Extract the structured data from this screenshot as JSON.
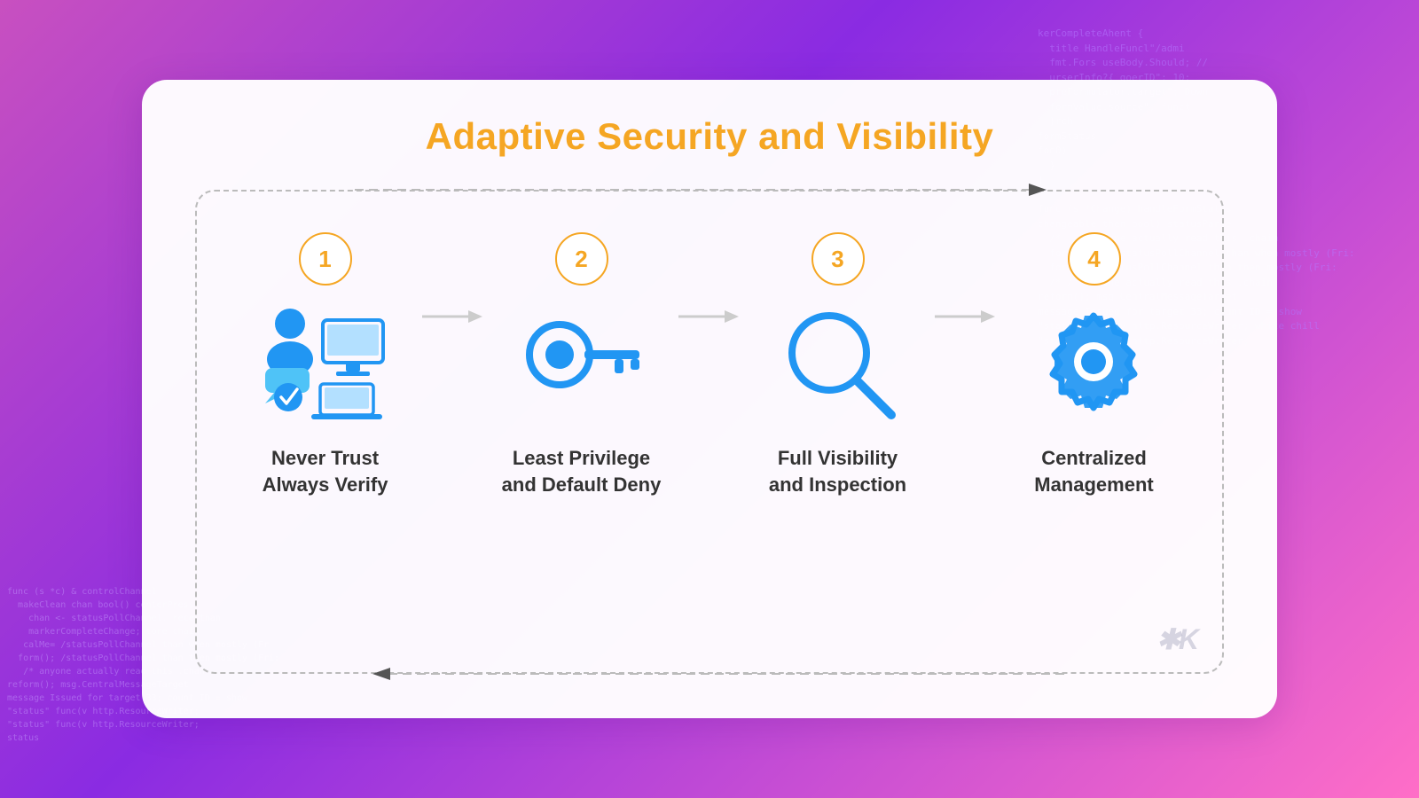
{
  "page": {
    "title": "Adaptive Security and Visibility",
    "background_gradient": "linear-gradient(135deg, #c850c0 0%, #8a2be2 40%, #ff6ec7 100%)"
  },
  "steps": [
    {
      "number": "1",
      "label": "Never Trust\nAlways Verify",
      "icon": "user-device-icon"
    },
    {
      "number": "2",
      "label": "Least Privilege\nand Default Deny",
      "icon": "key-icon"
    },
    {
      "number": "3",
      "label": "Full Visibility\nand Inspection",
      "icon": "magnify-icon"
    },
    {
      "number": "4",
      "label": "Centralized\nManagement",
      "icon": "gear-icon"
    }
  ],
  "top_arrow_label": "→",
  "bottom_arrow_label": "←",
  "watermark": "✱K",
  "code_text_right": "kerCompleteAhent {\n  title HandleFuncl\"/admi\n  fmt.Fors useBody.Should; //\n  urserInfo?{ goerID\"; 10;\n  preFormulator.target\"; Down\n  formValue.source\"; funct\n  }rch\nformStatus\nfoo0);\n  }\n}\n\nfunc (s *Change) handleFormStatus\nchangeable then bool) statusParse\n  /* --> anyone actually read this .chain\n  formGetML; /statusPollChannel than when mostly (Fri:\n  form(); /statusPollChannel than then mostly (Fri:\n  /* /* anyone actually read this .chain\nreform(); msg.CentralMessageTarget\nmessage Issued for target 33; count ID = show\n\"status\" func(v http.ResourceWriter; white chill\n\"status\" func(v http.ResourceWriter;",
  "code_text_left": "func (s *c) & controlChannel\n  makeClean chan bool() centerPress\n    chan <- statusPollChannel. receCthan\n    markerCompleteChange; tore chain\n   calMe= /statusPollChannel than when mostly (Fr\n  form(); /statusPollChannel than then mostly (Fri:\n   /* anyone actually read this .chan\nreform(); msg.CentralMessageTarget\nmessage Issued for target 33; count ID = show\n\"status\" func(v http.ResourceWriter;\n\"status\" func(v http.ResourceWriter;\nstatus"
}
